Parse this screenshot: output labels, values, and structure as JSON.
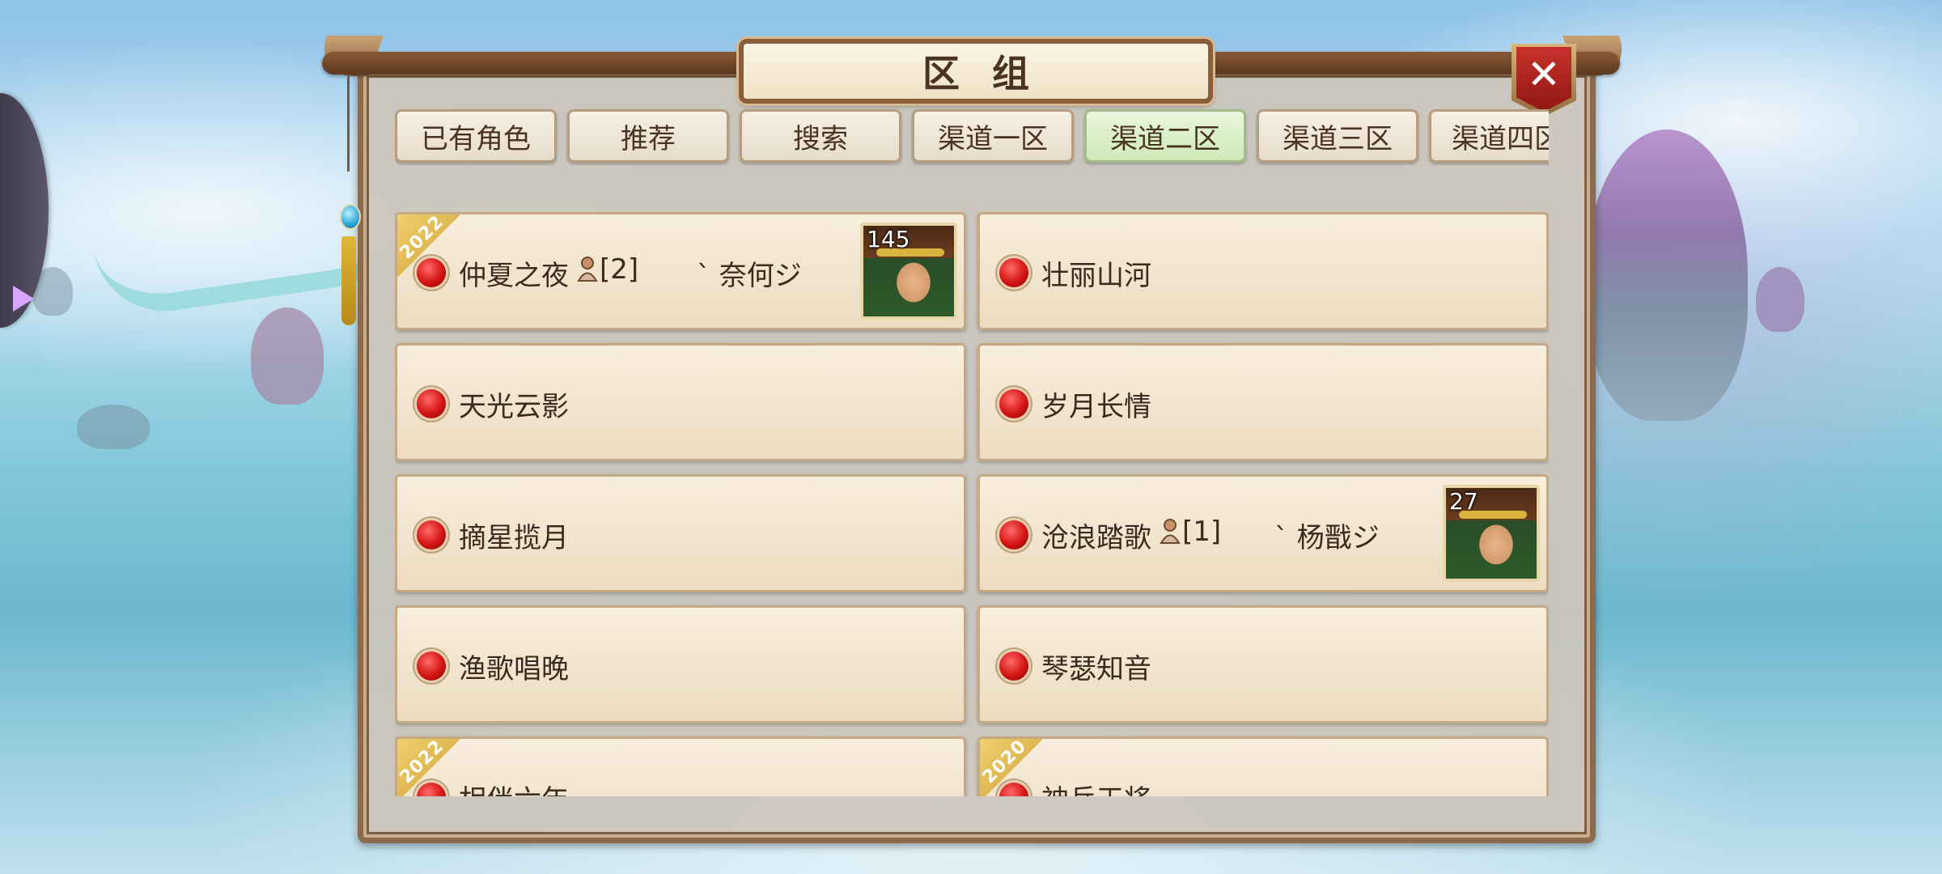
{
  "dialog": {
    "title": "区组",
    "close_icon": "close-icon"
  },
  "tabs": [
    {
      "label": "已有角色",
      "active": false
    },
    {
      "label": "推荐",
      "active": false
    },
    {
      "label": "搜索",
      "active": false
    },
    {
      "label": "渠道一区",
      "active": false
    },
    {
      "label": "渠道二区",
      "active": true
    },
    {
      "label": "渠道三区",
      "active": false
    },
    {
      "label": "渠道四区",
      "active": false
    }
  ],
  "servers": [
    {
      "name": "仲夏之夜",
      "year": "2022",
      "role_count": "[2]",
      "character": "ˋ 奈何ジ",
      "level": "145",
      "status": "red"
    },
    {
      "name": "壮丽山河",
      "status": "red"
    },
    {
      "name": "天光云影",
      "status": "red"
    },
    {
      "name": "岁月长情",
      "status": "red"
    },
    {
      "name": "摘星揽月",
      "status": "red"
    },
    {
      "name": "沧浪踏歌",
      "role_count": "[1]",
      "character": "ˋ 杨戬ジ",
      "level": "27",
      "status": "red"
    },
    {
      "name": "渔歌唱晚",
      "status": "red"
    },
    {
      "name": "琴瑟知音",
      "status": "red"
    },
    {
      "name": "相伴六年",
      "year": "2022",
      "status": "red"
    },
    {
      "name": "神兵天将",
      "year": "2020",
      "status": "red"
    }
  ],
  "colors": {
    "status_dot": "#d41414",
    "active_tab": "#cfeab7",
    "close_button": "#c8312b",
    "badge_gold": "#e0b94a"
  }
}
